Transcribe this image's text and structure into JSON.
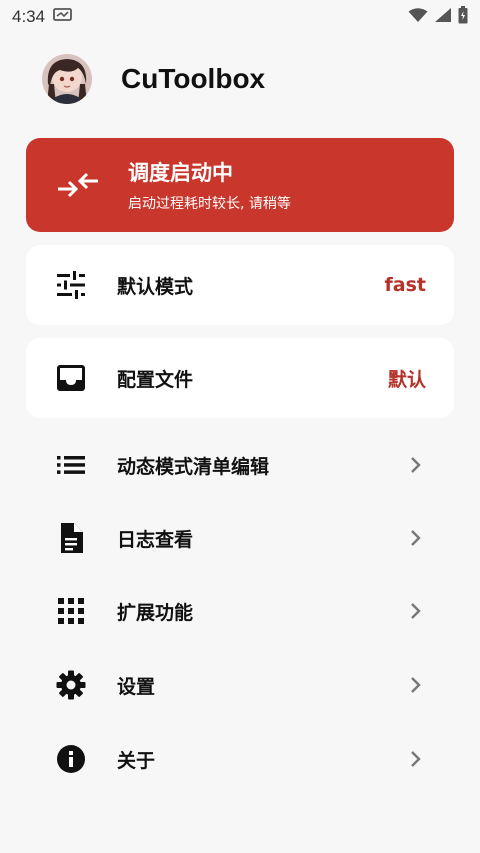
{
  "status_bar": {
    "time": "4:34"
  },
  "header": {
    "title": "CuToolbox"
  },
  "status_card": {
    "title": "调度启动中",
    "subtitle": "启动过程耗时较长, 请稍等",
    "color": "#c9372c"
  },
  "cards": [
    {
      "label": "默认模式",
      "value": "fast",
      "icon": "tune-icon"
    },
    {
      "label": "配置文件",
      "value": "默认",
      "icon": "inbox-icon"
    }
  ],
  "menu": [
    {
      "label": "动态模式清单编辑",
      "icon": "list-icon"
    },
    {
      "label": "日志查看",
      "icon": "document-icon"
    },
    {
      "label": "扩展功能",
      "icon": "apps-grid-icon"
    },
    {
      "label": "设置",
      "icon": "gear-icon"
    },
    {
      "label": "关于",
      "icon": "info-icon"
    }
  ],
  "colors": {
    "accent": "#b3322a",
    "background": "#f7f7f7",
    "card": "#ffffff"
  }
}
